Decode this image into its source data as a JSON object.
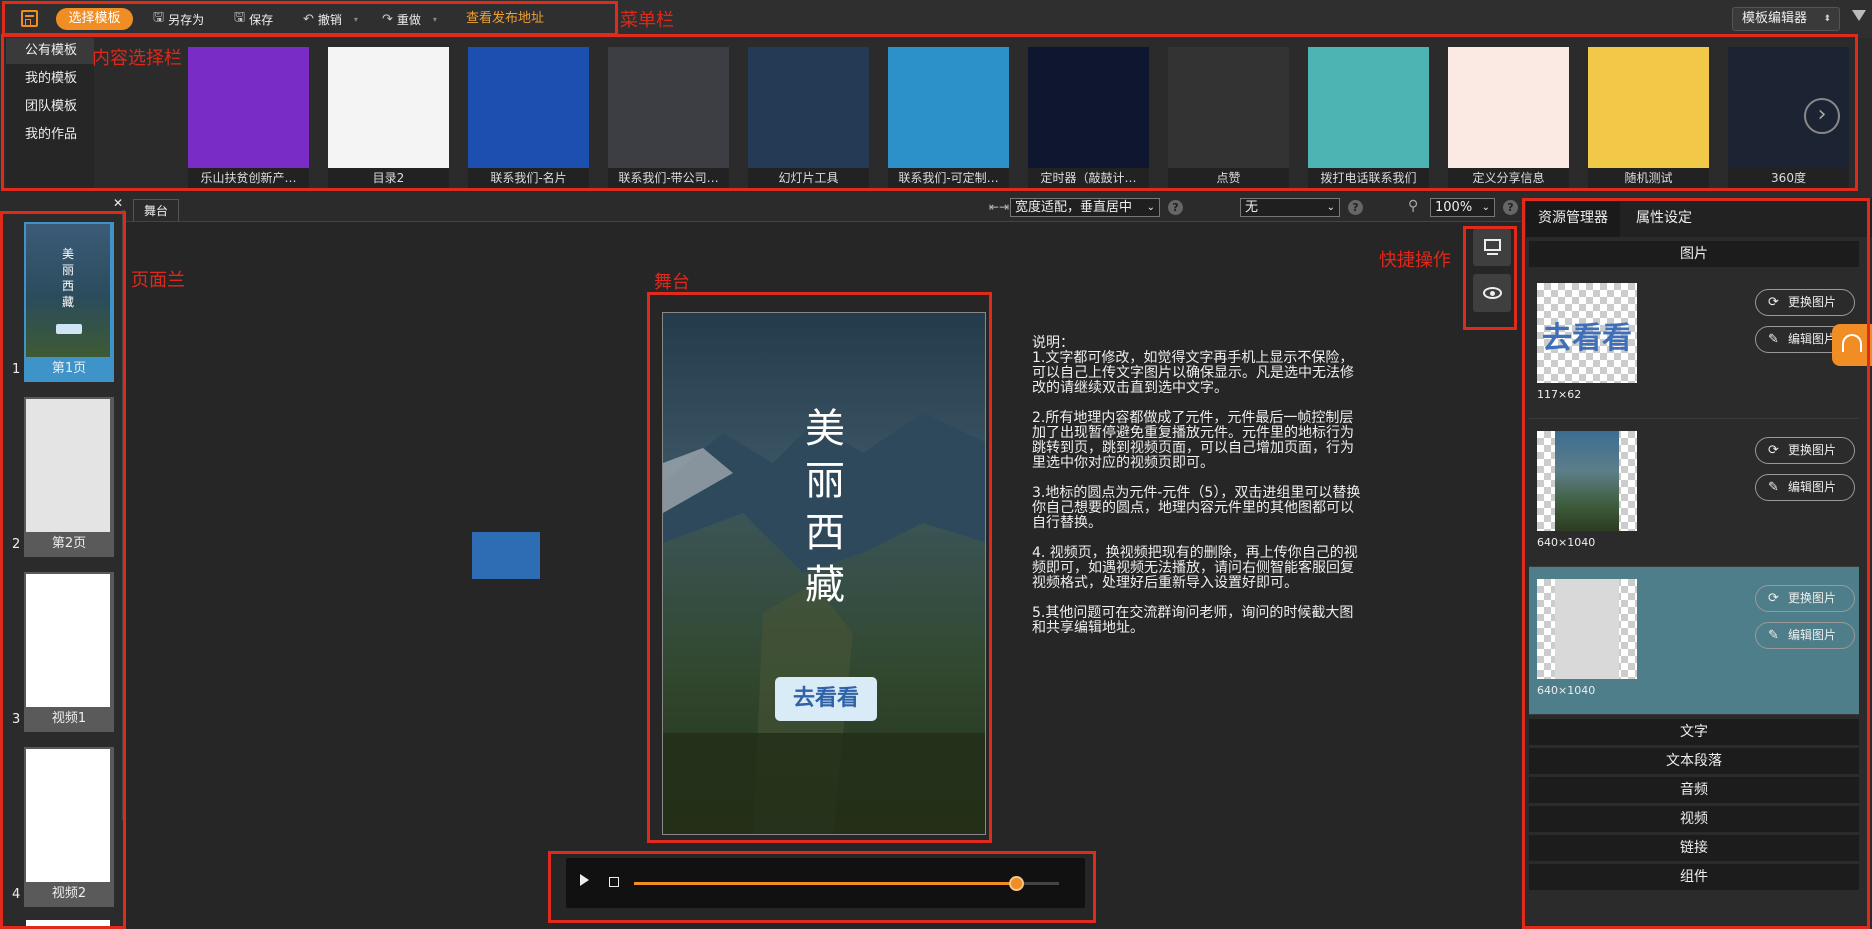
{
  "menubar": {
    "select_template": "选择模板",
    "save_as": "另存为",
    "save": "保存",
    "undo": "撤销",
    "redo": "重做",
    "view_publish": "查看发布地址",
    "editor_mode": "模板编辑器"
  },
  "annotations": {
    "menubar": "菜单栏",
    "content_select": "内容选择栏",
    "pagebar": "页面兰",
    "stage": "舞台",
    "quick_ops": "快捷操作"
  },
  "categories": [
    "公有模板",
    "我的模板",
    "团队模板",
    "我的作品"
  ],
  "templates": [
    {
      "label": "乐山扶贫创新产…",
      "bg": "#7a2cc7"
    },
    {
      "label": "目录2",
      "bg": "#f4f4f4"
    },
    {
      "label": "联系我们-名片",
      "bg": "#1d4fb0"
    },
    {
      "label": "联系我们-带公司…",
      "bg": "#3d3d44"
    },
    {
      "label": "幻灯片工具",
      "bg": "#243a55"
    },
    {
      "label": "联系我们-可定制…",
      "bg": "#2c91c8"
    },
    {
      "label": "定时器（敲鼓计…",
      "bg": "#0e1630"
    },
    {
      "label": "点赞",
      "bg": "#333"
    },
    {
      "label": "拨打电话联系我们",
      "bg": "#4db3b3"
    },
    {
      "label": "定义分享信息",
      "bg": "#fbe9e3"
    },
    {
      "label": "随机测试",
      "bg": "#f2c848"
    },
    {
      "label": "360度",
      "bg": "#1c2332"
    }
  ],
  "pages": [
    {
      "num": "1",
      "label": "第1页"
    },
    {
      "num": "2",
      "label": "第2页"
    },
    {
      "num": "3",
      "label": "视频1"
    },
    {
      "num": "4",
      "label": "视频2"
    }
  ],
  "stage": {
    "tab": "舞台",
    "fit_select": "宽度适配，垂直居中",
    "effect_select": "无",
    "zoom_select": "100%",
    "help": "?",
    "phone_title": [
      "美",
      "丽",
      "西",
      "藏"
    ],
    "phone_button": "去看看",
    "description": [
      "说明：",
      "1.文字都可修改，如觉得文字再手机上显示不保险，可以自己上传文字图片以确保显示。凡是选中无法修改的请继续双击直到选中文字。",
      "2.所有地理内容都做成了元件，元件最后一帧控制层加了出现暂停避免重复播放元件。元件里的地标行为跳转到页，跳到视频页面，可以自己增加页面，行为里选中你对应的视频页即可。",
      "3.地标的圆点为元件-元件（5），双击进组里可以替换你自己想要的圆点，地理内容元件里的其他图都可以自行替换。",
      "4. 视频页，换视频把现有的删除，再上传你自己的视频即可，如遇视频无法播放，请问右侧智能客服回复视频格式，处理好后重新导入设置好即可。",
      "5.其他问题可在交流群询问老师，询问的时候截大图和共享编辑地址。"
    ],
    "player_progress": 0.9
  },
  "right_panel": {
    "tabs": [
      "资源管理器",
      "属性设定"
    ],
    "section_image": "图片",
    "replace_image": "更换图片",
    "edit_image": "编辑图片",
    "assets": [
      {
        "dim": "117×62"
      },
      {
        "dim": "640×1040"
      },
      {
        "dim": "640×1040"
      }
    ],
    "sections": [
      "文字",
      "文本段落",
      "音频",
      "视频",
      "链接",
      "组件"
    ]
  },
  "colors": {
    "accent": "#f08d24",
    "annotation": "#e02a1b",
    "selected_asset": "#4f7e8b"
  }
}
